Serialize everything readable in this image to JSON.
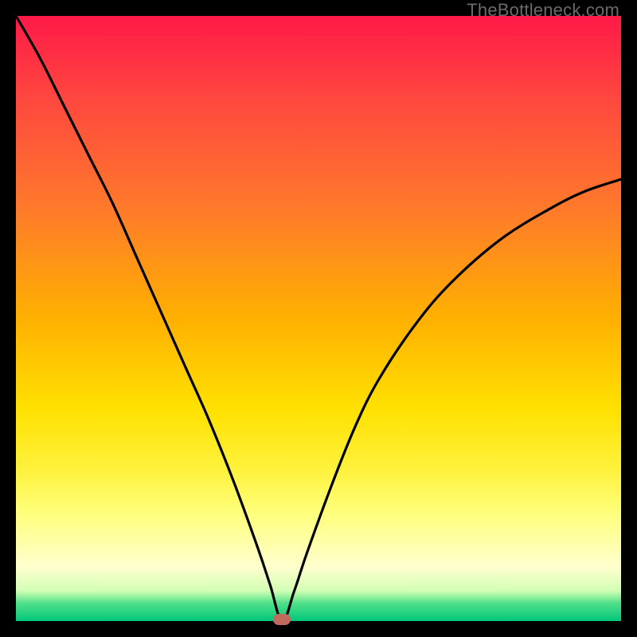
{
  "watermark": "TheBottleneck.com",
  "colors": {
    "frame_border": "#000000",
    "curve_stroke": "#000000",
    "marker_fill": "#c16a5e",
    "gradient_top": "#ff1a48",
    "gradient_bottom": "#00c77a"
  },
  "chart_data": {
    "type": "line",
    "title": "",
    "xlabel": "",
    "ylabel": "",
    "xlim": [
      0,
      100
    ],
    "ylim": [
      0,
      100
    ],
    "grid": false,
    "notes": "Gradient background from red (top / bad) to green (bottom / good). Black V-shaped bottleneck curve with minimum near x≈44. Small rounded marker at the curve minimum on the green floor.",
    "marker": {
      "x": 44,
      "y": 0
    },
    "series": [
      {
        "name": "bottleneck-curve",
        "x": [
          0,
          4,
          8,
          12,
          16,
          20,
          24,
          28,
          32,
          36,
          40,
          42,
          44,
          46,
          48,
          52,
          56,
          60,
          66,
          72,
          80,
          88,
          94,
          100
        ],
        "y": [
          100,
          93,
          85,
          77,
          69,
          60,
          51,
          42,
          33,
          23,
          12,
          6,
          0,
          5,
          11,
          22,
          32,
          40,
          49,
          56,
          63,
          68,
          71,
          73
        ]
      }
    ]
  }
}
